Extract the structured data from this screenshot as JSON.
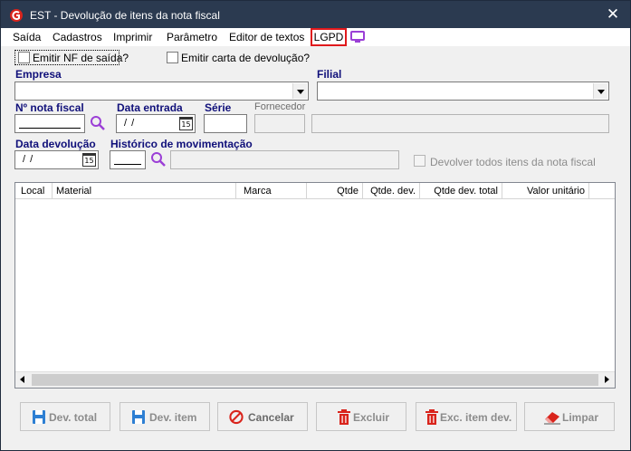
{
  "window": {
    "title": "EST - Devolução de itens da nota fiscal",
    "close_glyph": "✕"
  },
  "menu": {
    "items": [
      "Saída",
      "Cadastros",
      "Imprimir",
      "Parâmetro",
      "Editor de textos"
    ],
    "lgpd": "LGPD"
  },
  "options": {
    "emitir_nf": "Emitir NF de saída?",
    "emitir_carta": "Emitir carta de devolução?"
  },
  "form": {
    "empresa_label": "Empresa",
    "filial_label": "Filial",
    "nota_label": "Nº nota fiscal",
    "data_entrada_label": "Data entrada",
    "serie_label": "Série",
    "fornecedor_label": "Fornecedor",
    "data_devolucao_label": "Data devolução",
    "historico_label": "Histórico de movimentação",
    "date_placeholder": "/ /",
    "calendar_glyph": "15",
    "devolver_todos": "Devolver todos itens da nota fiscal"
  },
  "grid": {
    "columns": [
      "Local",
      "Material",
      "Marca",
      "Qtde",
      "Qtde. dev.",
      "Qtde dev. total",
      "Valor unitário"
    ]
  },
  "buttons": {
    "dev_total": "Dev. total",
    "dev_item": "Dev. item",
    "cancelar": "Cancelar",
    "excluir": "Excluir",
    "exc_item_dev": "Exc. item dev.",
    "limpar": "Limpar"
  },
  "colors": {
    "titlebar": "#2b3a50",
    "label_blue": "#10107a",
    "lgpd_border": "#e0191c",
    "search_icon": "#9b3fd6",
    "save_icon": "#2d7fd3",
    "delete_icon": "#d9241c"
  }
}
